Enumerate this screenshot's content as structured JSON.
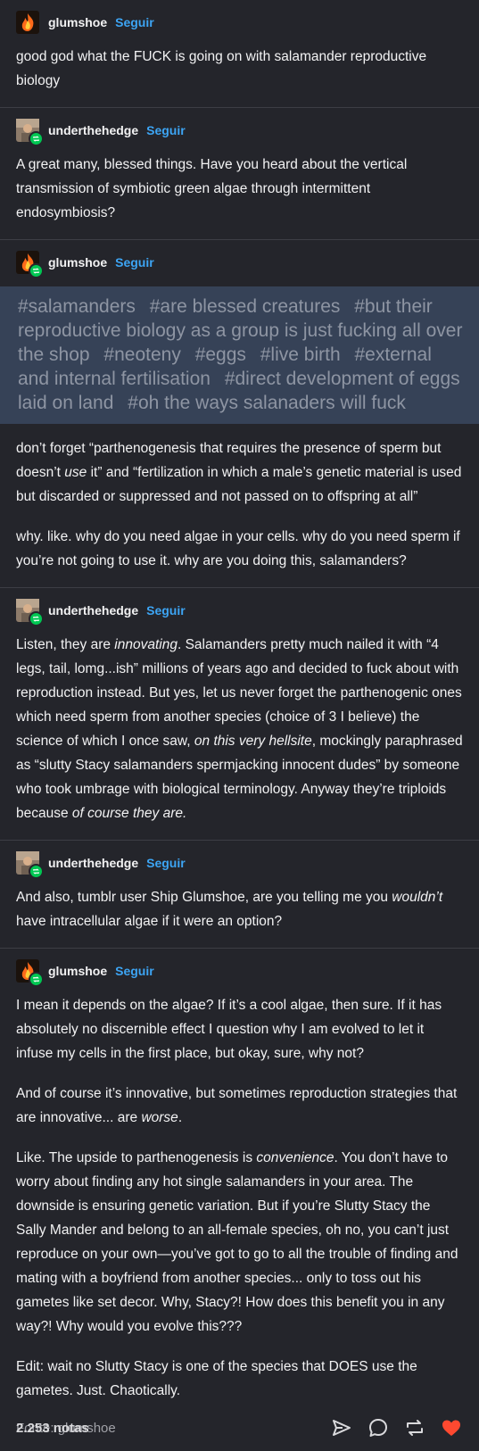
{
  "colors": {
    "background": "#24252b",
    "follow_link": "#3da5f4",
    "tag_block_bg": "#364257",
    "tag_text": "#8e95a3",
    "like_heart": "#ff4930",
    "reblog_badge": "#00c853"
  },
  "follow_label": "Seguir",
  "posts": [
    {
      "username": "glumshoe",
      "avatar_icon": "fire-avatar-icon",
      "paragraphs": [
        "good god what the FUCK is going on with salamander reproductive biology"
      ]
    },
    {
      "username": "underthehedge",
      "avatar_icon": "photo-avatar-icon",
      "paragraphs": [
        "A great many, blessed things. Have you heard about the vertical transmission of symbiotic green algae through intermittent endosymbiosis?"
      ]
    },
    {
      "username": "glumshoe",
      "avatar_icon": "fire-avatar-icon",
      "tags": [
        "#salamanders",
        "#are blessed creatures",
        "#but their reproductive biology as a group is just fucking all over the shop",
        "#neoteny",
        "#eggs",
        "#live birth",
        "#external and internal fertilisation",
        "#direct development of eggs laid on land",
        "#oh the ways salanaders will fuck"
      ],
      "p1": {
        "a": "don’t forget “parthenogenesis that requires the presence of sperm but doesn’t ",
        "em": "use",
        "b": " it” and “fertilization in which a male’s genetic material is used but discarded or suppressed and not passed on to offspring at all”"
      },
      "p2": "why. like. why do you need algae in your cells. why do you need sperm if you’re not going to use it. why are you doing this, salamanders?"
    },
    {
      "username": "underthehedge",
      "avatar_icon": "photo-avatar-icon",
      "p1": {
        "a": "Listen, they are ",
        "em1": "innovating",
        "b": ". Salamanders pretty much nailed it with “4 legs, tail, lomg...ish” millions of years ago and decided to fuck about with reproduction instead. But yes, let us never forget the parthenogenic ones which need sperm from another species (choice of 3 I believe) the science of which I once saw, ",
        "em2": "on this very hellsite",
        "c": ", mockingly paraphrased as “slutty Stacy salamanders spermjacking innocent dudes” by someone who took umbrage with biological terminology. Anyway they’re triploids because ",
        "em3": "of course they are."
      }
    },
    {
      "username": "underthehedge",
      "avatar_icon": "photo-avatar-icon",
      "p1": {
        "a": "And also, tumblr user Ship Glumshoe, are you telling me you ",
        "em": "wouldn’t",
        "b": " have intracellular algae if it were an option?"
      }
    },
    {
      "username": "glumshoe",
      "avatar_icon": "fire-avatar-icon",
      "p1": "I mean it depends on the algae? If it’s a cool algae, then sure. If it has absolutely no discernible effect I question why I am evolved to let it infuse my cells in the first place, but okay, sure, why not?",
      "p2": {
        "a": "And of course it’s innovative, but sometimes reproduction strategies that are innovative... are ",
        "em": "worse",
        "b": "."
      },
      "p3": {
        "a": "Like. The upside to parthenogenesis is ",
        "em": "convenience",
        "b": ". You don’t have to worry about finding any hot single salamanders in your area. The downside is ensuring genetic variation. But if you’re Slutty Stacy the Sally Mander and belong to an all-female species, oh no, you can’t just reproduce on your own—you’ve got to go to all the trouble of finding and mating with a boyfriend from another species... only to toss out his gametes like set decor. Why, Stacy?! How does this benefit you in any way?! Why would you evolve this???"
      },
      "p4": "Edit: wait no Slutty Stacy is one of the species that DOES use the gametes. Just. Chaotically."
    }
  ],
  "footer": {
    "source": "Fonte: glumshoe",
    "notes": "2.253 notas",
    "actions": [
      "share-icon",
      "reply-icon",
      "reblog-icon",
      "like-heart-icon"
    ]
  }
}
